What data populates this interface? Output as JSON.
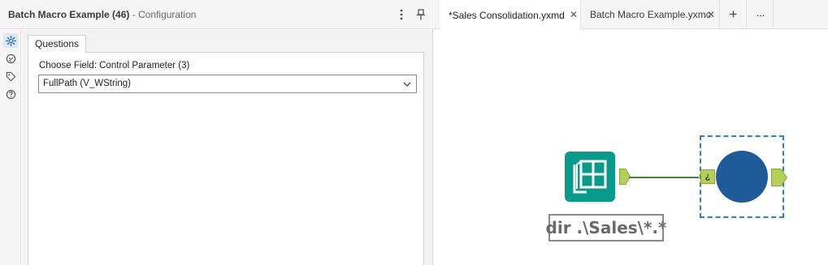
{
  "config": {
    "tool_name": "Batch Macro Example (46)",
    "separator": " - ",
    "panel_name": "Configuration",
    "more_icon": "vertical-ellipsis-icon",
    "pin_icon": "pin-icon",
    "rail_icons": [
      "gear-icon",
      "connection-icon",
      "tag-icon",
      "help-icon"
    ],
    "tab_label": "Questions",
    "question_label": "Choose Field: Control Parameter (3)",
    "select_value": "FullPath (V_WString)"
  },
  "canvas": {
    "tabs": [
      {
        "label": "*Sales Consolidation.yxmd",
        "close": "✕"
      },
      {
        "label": "Batch Macro Example.yxmc",
        "close": "✕"
      }
    ],
    "add_label": "+",
    "more_label": "···",
    "input_anchor_label": "¿",
    "annotation_text": "dir .\\Sales\\*.*",
    "colors": {
      "input_tool": "#0a9a8c",
      "macro_tool": "#1f5b99",
      "anchor": "#b5d05a",
      "connection": "#3a8a3a",
      "selection": "#2f7fc1"
    }
  }
}
